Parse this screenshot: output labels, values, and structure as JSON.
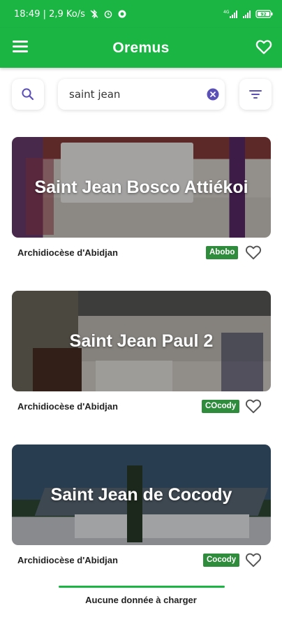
{
  "status_bar": {
    "time_speed": "18:49 | 2,9 Ko/s",
    "network": "4G",
    "battery": "92"
  },
  "app_bar": {
    "title": "Oremus",
    "menu_icon": "menu-icon",
    "favorites_icon": "heart-outline-icon"
  },
  "search": {
    "value": "saint jean",
    "search_icon": "search-icon",
    "clear_icon": "clear-circle-icon",
    "filter_icon": "filter-icon"
  },
  "results": [
    {
      "name": "Saint Jean Bosco Attiékoi",
      "diocese": "Archidiocèse d'Abidjan",
      "commune": "Abobo"
    },
    {
      "name": "Saint Jean Paul 2",
      "diocese": "Archidiocèse d'Abidjan",
      "commune": "COcody"
    },
    {
      "name": "Saint Jean de Cocody",
      "diocese": "Archidiocèse d'Abidjan",
      "commune": "Cocody"
    }
  ],
  "footer": {
    "message": "Aucune donnée à charger"
  },
  "colors": {
    "primary": "#1ab543",
    "badge": "#2e8c3c",
    "accent": "#5b4fb8"
  }
}
